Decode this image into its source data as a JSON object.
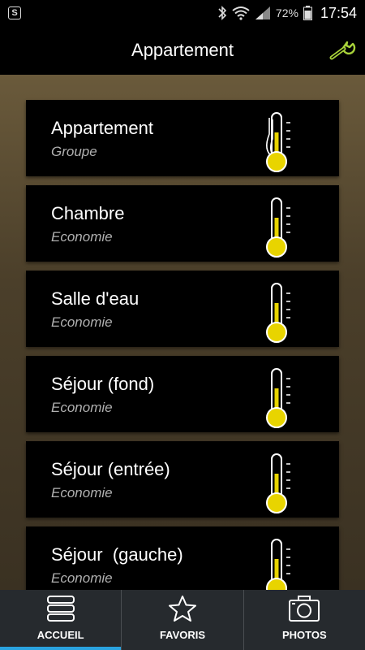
{
  "status_bar": {
    "battery_percent": "72%",
    "time": "17:54"
  },
  "header": {
    "title": "Appartement",
    "settings_icon": "wrench-icon",
    "accent_color": "#a8d23a"
  },
  "rooms": [
    {
      "name": "Appartement",
      "mode": "Groupe",
      "icon": "thermometer-group-icon"
    },
    {
      "name": "Chambre",
      "mode": "Economie",
      "icon": "thermometer-icon"
    },
    {
      "name": "Salle d'eau",
      "mode": "Economie",
      "icon": "thermometer-icon"
    },
    {
      "name": "Séjour (fond)",
      "mode": "Economie",
      "icon": "thermometer-icon"
    },
    {
      "name": "Séjour (entrée)",
      "mode": "Economie",
      "icon": "thermometer-icon"
    },
    {
      "name": "Séjour  (gauche)",
      "mode": "Economie",
      "icon": "thermometer-icon"
    }
  ],
  "thermometer_color": "#e8d400",
  "bottom_nav": {
    "tabs": [
      {
        "label": "ACCUEIL",
        "icon": "list-icon",
        "active": true
      },
      {
        "label": "FAVORIS",
        "icon": "star-icon",
        "active": false
      },
      {
        "label": "PHOTOS",
        "icon": "camera-icon",
        "active": false
      }
    ],
    "active_color": "#2aa3e0"
  }
}
